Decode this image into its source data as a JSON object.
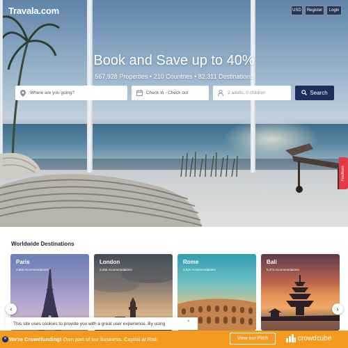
{
  "header": {
    "logo": "Travala.com",
    "currency_label": "USD",
    "register_label": "Register",
    "login_label": "Login"
  },
  "hero": {
    "title": "Book and Save up to 40%",
    "subtitle": "567,928 Properties  •  210 Countries  •  82,311 Destinations",
    "search": {
      "destination_placeholder": "Where are you going?",
      "dates_value": "Check in - Check out",
      "guests_value": "2 adults, 0 children",
      "search_label": "Search"
    },
    "feedback_label": "Feedback"
  },
  "destinations": {
    "title": "Worldwide Destinations",
    "cards": [
      {
        "name": "Paris",
        "accommodations": "2,603 Accommodations"
      },
      {
        "name": "London",
        "accommodations": "2,455 Accommodations"
      },
      {
        "name": "Rome",
        "accommodations": "4,631 Accommodations"
      },
      {
        "name": "Bali",
        "accommodations": "5,372 Accommodations"
      }
    ],
    "prev_icon": "chevron-left-icon",
    "next_icon": "chevron-right-icon"
  },
  "cookie": {
    "text": "This site uses cookies to provide you with a great user experience. By using",
    "close_label": "×"
  },
  "crowdfunding": {
    "highlight": "We're Crowdfunding!",
    "text": " Own part of our business. Capital at Risk",
    "button_label": "View our Pitch",
    "brand": "crowdcube"
  },
  "colors": {
    "navy": "#1f2d5c",
    "orange": "#f39a1f",
    "feedback_red": "#e53945"
  }
}
